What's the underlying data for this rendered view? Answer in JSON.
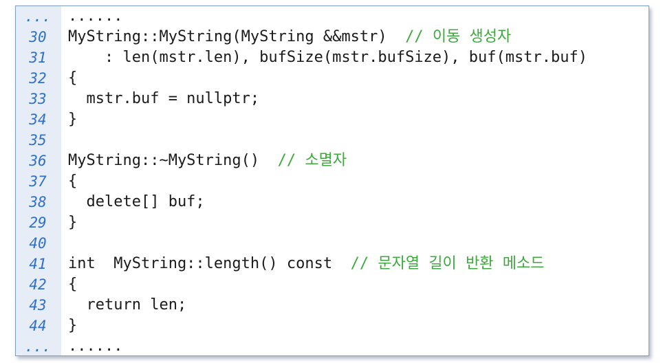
{
  "lines": [
    {
      "num": "...",
      "code": "......",
      "comment": ""
    },
    {
      "num": "30",
      "code": "MyString::MyString(MyString &&mstr)  ",
      "comment": "// 이동 생성자"
    },
    {
      "num": "31",
      "code": "    : len(mstr.len), bufSize(mstr.bufSize), buf(mstr.buf)",
      "comment": ""
    },
    {
      "num": "32",
      "code": "{",
      "comment": ""
    },
    {
      "num": "33",
      "code": "  mstr.buf = nullptr;",
      "comment": ""
    },
    {
      "num": "34",
      "code": "}",
      "comment": ""
    },
    {
      "num": "35",
      "code": "",
      "comment": ""
    },
    {
      "num": "36",
      "code": "MyString::~MyString()  ",
      "comment": "// 소멸자"
    },
    {
      "num": "37",
      "code": "{",
      "comment": ""
    },
    {
      "num": "38",
      "code": "  delete[] buf;",
      "comment": ""
    },
    {
      "num": "29",
      "code": "}",
      "comment": ""
    },
    {
      "num": "40",
      "code": "",
      "comment": ""
    },
    {
      "num": "41",
      "code": "int  MyString::length() const  ",
      "comment": "// 문자열 길이 반환 메소드"
    },
    {
      "num": "42",
      "code": "{",
      "comment": ""
    },
    {
      "num": "43",
      "code": "  return len;",
      "comment": ""
    },
    {
      "num": "44",
      "code": "}",
      "comment": ""
    },
    {
      "num": "...",
      "code": "......",
      "comment": ""
    }
  ],
  "colors": {
    "line_number": "#2f6fc8",
    "comment": "#3aaa3a",
    "code": "#1a1a1a",
    "gutter_bg": "#e6edf7",
    "border": "#7f9bc8"
  }
}
